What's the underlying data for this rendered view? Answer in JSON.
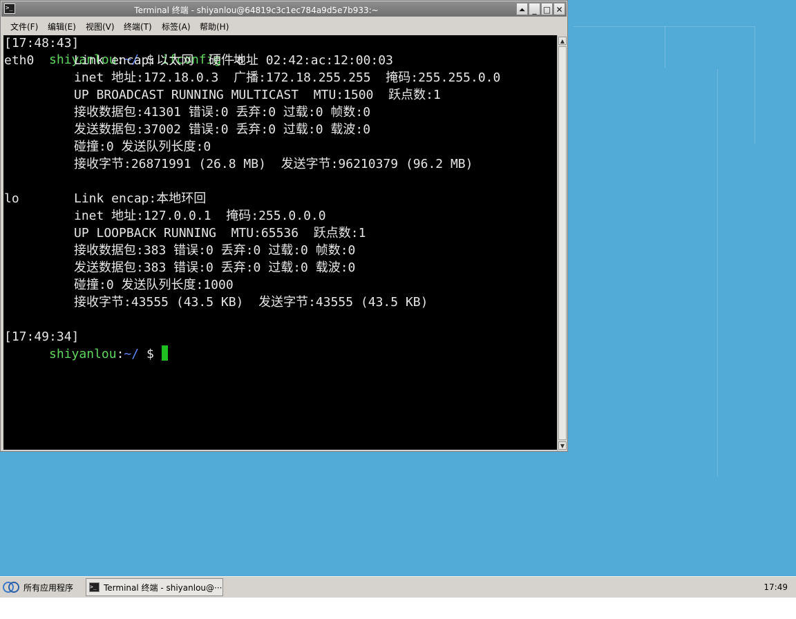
{
  "window": {
    "title": "Terminal 终端 - shiyanlou@64819c3c1ec784a9d5e7b933:~",
    "controls": [
      "⏶",
      "_",
      "□",
      "✕"
    ],
    "icon": "terminal-icon"
  },
  "menubar": {
    "items": [
      "文件(F)",
      "编辑(E)",
      "视图(V)",
      "终端(T)",
      "标签(A)",
      "帮助(H)"
    ]
  },
  "terminal": {
    "prompt1": {
      "user": "shiyanlou",
      "path": "~/",
      "symbol": " $ ",
      "command": "ifconfig",
      "args": " -a",
      "time": "[17:48:43]"
    },
    "lines": [
      {
        "label": "eth0",
        "text": "Link encap:以太网  硬件地址 02:42:ac:12:00:03"
      },
      {
        "label": "",
        "text": "inet 地址:172.18.0.3  广播:172.18.255.255  掩码:255.255.0.0"
      },
      {
        "label": "",
        "text": "UP BROADCAST RUNNING MULTICAST  MTU:1500  跃点数:1"
      },
      {
        "label": "",
        "text": "接收数据包:41301 错误:0 丢弃:0 过载:0 帧数:0"
      },
      {
        "label": "",
        "text": "发送数据包:37002 错误:0 丢弃:0 过载:0 载波:0"
      },
      {
        "label": "",
        "text": "碰撞:0 发送队列长度:0"
      },
      {
        "label": "",
        "text": "接收字节:26871991 (26.8 MB)  发送字节:96210379 (96.2 MB)"
      },
      {
        "label": "",
        "text": ""
      },
      {
        "label": "lo",
        "text": "Link encap:本地环回"
      },
      {
        "label": "",
        "text": "inet 地址:127.0.0.1  掩码:255.0.0.0"
      },
      {
        "label": "",
        "text": "UP LOOPBACK RUNNING  MTU:65536  跃点数:1"
      },
      {
        "label": "",
        "text": "接收数据包:383 错误:0 丢弃:0 过载:0 帧数:0"
      },
      {
        "label": "",
        "text": "发送数据包:383 错误:0 丢弃:0 过载:0 载波:0"
      },
      {
        "label": "",
        "text": "碰撞:0 发送队列长度:1000"
      },
      {
        "label": "",
        "text": "接收字节:43555 (43.5 KB)  发送字节:43555 (43.5 KB)"
      },
      {
        "label": "",
        "text": ""
      }
    ],
    "prompt2": {
      "user": "shiyanlou",
      "path": "~/",
      "symbol": " $ ",
      "time": "[17:49:34]"
    }
  },
  "taskbar": {
    "start_label": "所有应用程序",
    "start_icon": "app-menu-icon",
    "task_label": "Terminal 终端 - shiyanlou@···",
    "task_icon": "terminal-icon",
    "clock": "17:49"
  },
  "colors": {
    "desktop": "#52aad6",
    "prompt_user": "#5fd75f",
    "prompt_path": "#5f87ff",
    "cursor": "#1fbf1f"
  }
}
